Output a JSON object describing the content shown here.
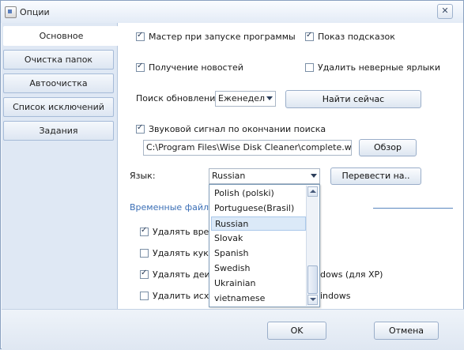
{
  "window": {
    "title": "Опции",
    "close_glyph": "✕"
  },
  "sidebar": {
    "items": [
      {
        "label": "Основное",
        "active": true
      },
      {
        "label": "Очистка папок",
        "active": false
      },
      {
        "label": "Автоочистка",
        "active": false
      },
      {
        "label": "Список исключений",
        "active": false
      },
      {
        "label": "Задания",
        "active": false
      }
    ]
  },
  "options": {
    "wizard_on_start": {
      "label": "Мастер при запуске программы",
      "checked": true
    },
    "show_tips": {
      "label": "Показ подсказок",
      "checked": true
    },
    "get_news": {
      "label": "Получение новостей",
      "checked": true
    },
    "delete_bad_shortcuts": {
      "label": "Удалить неверные ярлыки",
      "checked": false
    }
  },
  "updates": {
    "label": "Поиск обновлений",
    "frequency_value": "Еженедел",
    "find_now_label": "Найти сейчас"
  },
  "sound": {
    "label": "Звуковой сигнал по окончании поиска",
    "checked": true,
    "path_value": "C:\\Program Files\\Wise Disk Cleaner\\complete.wav",
    "browse_label": "Обзор"
  },
  "language": {
    "label": "Язык:",
    "selected": "Russian",
    "translate_label": "Перевести на..",
    "dropdown_items": [
      "Polish (polski)",
      "Portuguese(Brasil)",
      "Russian",
      "Slovak",
      "Spanish",
      "Swedish",
      "Ukrainian",
      "vietnamese"
    ]
  },
  "temp_files": {
    "header": "Временные файлы I",
    "items": [
      {
        "label": "Удалять врем",
        "checked": true
      },
      {
        "label": "Удалять куки",
        "checked": false
      },
      {
        "label": "Удалять деин",
        "suffix": "dows (для XP)",
        "checked": true
      },
      {
        "label": "Удалить исхо",
        "suffix": "indows",
        "checked": false
      }
    ]
  },
  "footer": {
    "ok_label": "OK",
    "cancel_label": "Отмена"
  },
  "colors": {
    "accent": "#3b6fb6",
    "sidebar_bg": "#dfe8f4",
    "selection": "#dbe9f8"
  }
}
